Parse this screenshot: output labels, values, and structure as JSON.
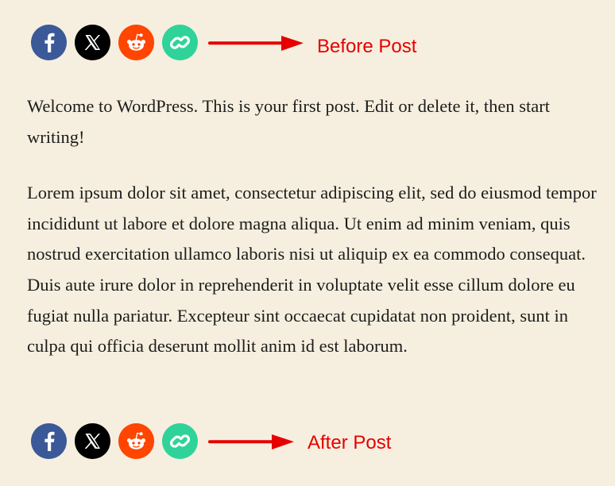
{
  "colors": {
    "background": "#f6efdf",
    "facebook": "#3b5998",
    "x": "#000000",
    "reddit": "#ff4500",
    "copy_link": "#2fd39a",
    "annotation": "#e60000"
  },
  "share_bar": {
    "buttons": [
      {
        "name": "facebook",
        "icon": "facebook-icon"
      },
      {
        "name": "x",
        "icon": "x-icon"
      },
      {
        "name": "reddit",
        "icon": "reddit-icon"
      },
      {
        "name": "copy-link",
        "icon": "link-icon"
      }
    ]
  },
  "annotations": {
    "before_label": "Before Post",
    "after_label": "After Post"
  },
  "post": {
    "paragraphs": [
      "Welcome to WordPress. This is your first post. Edit or delete it, then start writing!",
      "Lorem ipsum dolor sit amet, consectetur adipiscing elit, sed do eiusmod tempor incididunt ut labore et dolore magna aliqua. Ut enim ad minim veniam, quis nostrud exercitation ullamco laboris nisi ut aliquip ex ea commodo consequat. Duis aute irure dolor in reprehenderit in voluptate velit esse cillum dolore eu fugiat nulla pariatur. Excepteur sint occaecat cupidatat non proident, sunt in culpa qui officia deserunt mollit anim id est laborum."
    ]
  }
}
